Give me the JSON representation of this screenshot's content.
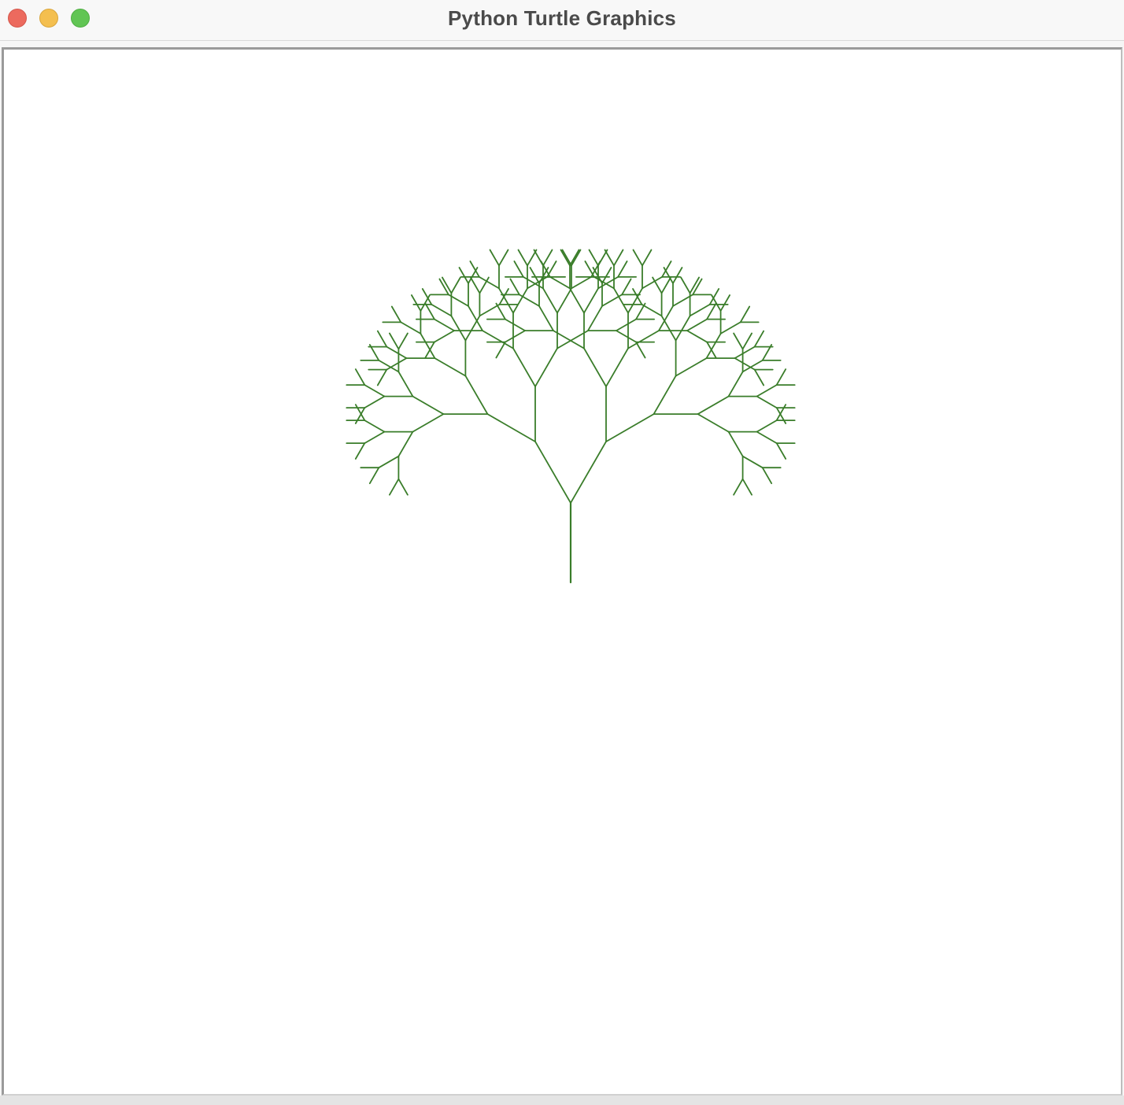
{
  "window": {
    "title": "Python Turtle Graphics",
    "controls": [
      "close",
      "minimize",
      "zoom"
    ]
  },
  "canvas": {
    "background": "#ffffff",
    "drawing": {
      "kind": "recursive-fractal-tree",
      "pen_color": "#3a7d2a",
      "branch_angle_degrees": 30,
      "depth": 7
    }
  }
}
